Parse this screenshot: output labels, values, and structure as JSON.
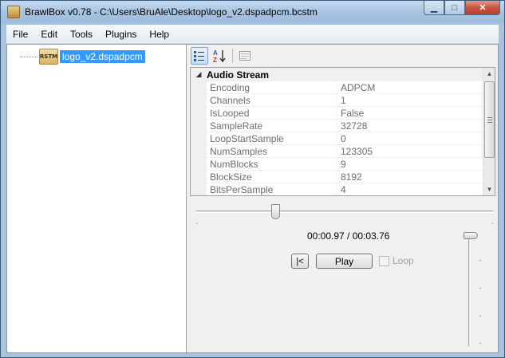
{
  "window": {
    "title": "BrawlBox v0.78 - C:\\Users\\BruAle\\Desktop\\logo_v2.dspadpcm.bcstm",
    "minimize_icon": "minimize-icon",
    "maximize_icon": "maximize-icon",
    "close_icon": "close-icon"
  },
  "menu": [
    "File",
    "Edit",
    "Tools",
    "Plugins",
    "Help"
  ],
  "tree": {
    "node_icon_text": "RSTM",
    "node_label": "logo_v2.dspadpcm"
  },
  "propertygrid": {
    "category": "Audio Stream",
    "rows": [
      {
        "name": "Encoding",
        "value": "ADPCM"
      },
      {
        "name": "Channels",
        "value": "1"
      },
      {
        "name": "IsLooped",
        "value": "False"
      },
      {
        "name": "SampleRate",
        "value": "32728"
      },
      {
        "name": "LoopStartSample",
        "value": "0"
      },
      {
        "name": "NumSamples",
        "value": "123305"
      },
      {
        "name": "NumBlocks",
        "value": "9"
      },
      {
        "name": "BlockSize",
        "value": "8192"
      },
      {
        "name": "BitsPerSample",
        "value": "4"
      }
    ]
  },
  "player": {
    "time": "00:00.97 / 00:03.76",
    "restart_label": "|<",
    "play_label": "Play",
    "loop_label": "Loop",
    "loop_checked": false,
    "seek_fraction": 0.26,
    "volume_fraction": 1.0
  }
}
